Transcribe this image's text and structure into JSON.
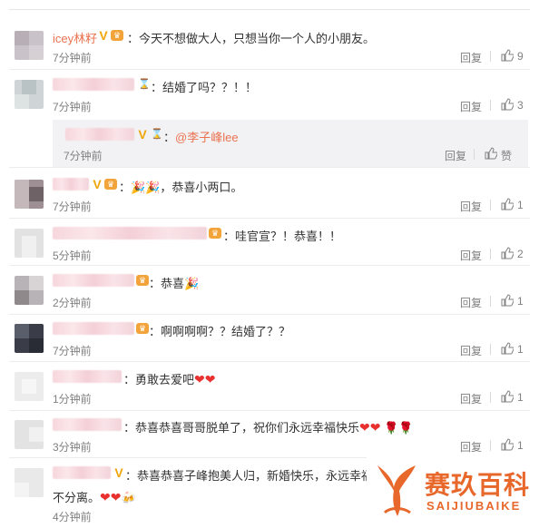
{
  "comments": [
    {
      "username": "icey林籽",
      "text": "今天不想做大人，只想当你一个人的小朋友。",
      "time": "7分钟前",
      "reply": "回复",
      "likes": "9"
    },
    {
      "text": "结婚了吗？？！！",
      "time": "7分钟前",
      "reply": "回复",
      "likes": "3",
      "sub_reply": {
        "mention": "@李子峰lee",
        "time": "7分钟前",
        "reply": "回复",
        "likes": "赞"
      }
    },
    {
      "text": "恭喜小两口。",
      "time": "7分钟前",
      "reply": "回复",
      "likes": "1"
    },
    {
      "text": "哇官宣？！恭喜！！",
      "time": "5分钟前",
      "reply": "回复",
      "likes": "2"
    },
    {
      "text": "恭喜",
      "time": "2分钟前",
      "reply": "回复",
      "likes": "1"
    },
    {
      "text": "啊啊啊啊？？结婚了？？",
      "time": "7分钟前",
      "reply": "回复",
      "likes": "1"
    },
    {
      "text": "勇敢去爱吧",
      "time": "1分钟前",
      "reply": "回复",
      "likes": "1"
    },
    {
      "text": "恭喜恭喜哥哥脱单了，祝你们永远幸福快乐",
      "time": "3分钟前",
      "reply": "回复",
      "likes": "1"
    },
    {
      "text": "恭喜恭喜子峰抱美人归，新婚快乐，永远幸福快乐",
      "text2": "不分离。",
      "time": "4分钟前",
      "reply": "回复"
    }
  ],
  "watermark": {
    "cn": "赛玖百科",
    "en": "SAIJIUBAIKE"
  },
  "colors": {
    "username": "#eb7350",
    "muted": "#808080",
    "reply_bg": "#f2f2f5",
    "watermark": "#e8672a"
  }
}
